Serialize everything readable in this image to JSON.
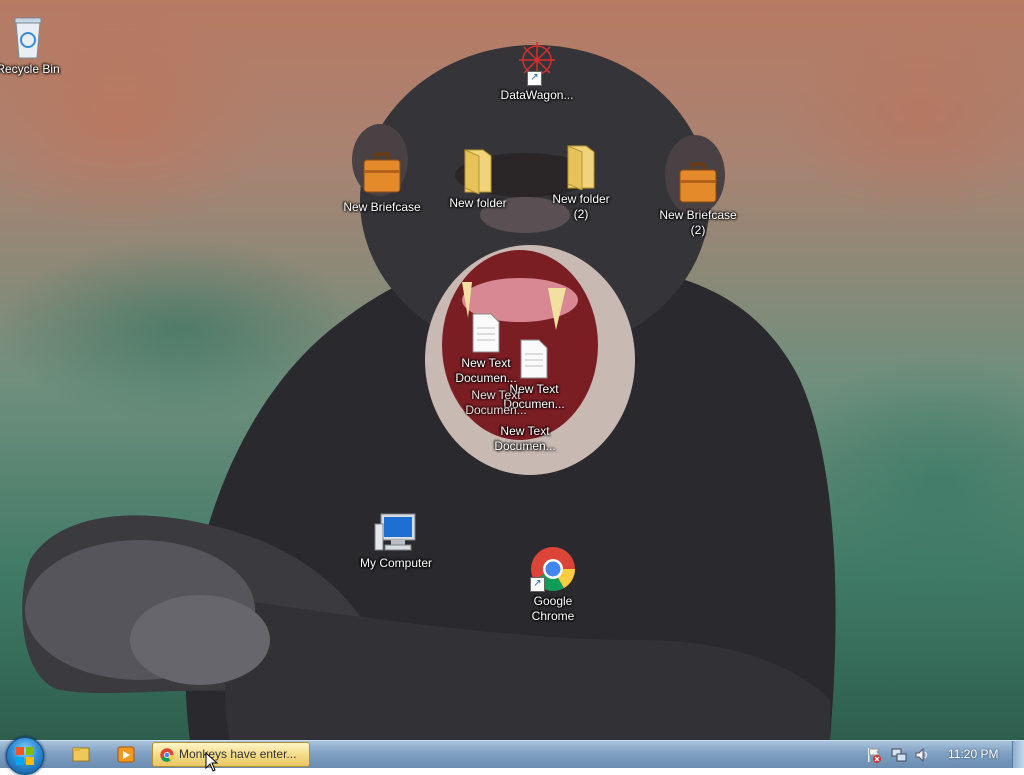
{
  "desktop": {
    "icons": [
      {
        "label": "Recycle Bin",
        "icon": "recycle-bin-icon"
      },
      {
        "label": "DataWagon...",
        "icon": "datawagon-shortcut-icon"
      },
      {
        "label": "New Briefcase",
        "icon": "briefcase-icon"
      },
      {
        "label": "New folder",
        "icon": "folder-icon"
      },
      {
        "label": "New folder\n(2)",
        "icon": "folder-icon"
      },
      {
        "label": "New Briefcase\n(2)",
        "icon": "briefcase-icon"
      },
      {
        "label": "New Text\nDocumen...",
        "icon": "text-document-icon"
      },
      {
        "label": "New Text\nDocumen...",
        "icon": "text-document-icon"
      },
      {
        "label": "New Text\nDocumen...",
        "icon": "text-document-icon"
      },
      {
        "label": "New Text\nDocumen...",
        "icon": "text-document-icon"
      },
      {
        "label": "My Computer",
        "icon": "my-computer-icon"
      },
      {
        "label": "Google\nChrome",
        "icon": "chrome-icon"
      }
    ]
  },
  "taskbar": {
    "pinned": [
      "file-explorer-icon",
      "media-player-icon"
    ],
    "active_window": {
      "title": "Monkeys have enter...",
      "icon": "chrome-icon"
    },
    "tray": [
      "action-center-flag-icon",
      "network-icon",
      "volume-icon"
    ],
    "clock": "11:20 PM"
  },
  "colors": {
    "taskbar": "#7fa0c2",
    "active_button": "#f4dc8a",
    "icon_label": "#ffffff"
  }
}
